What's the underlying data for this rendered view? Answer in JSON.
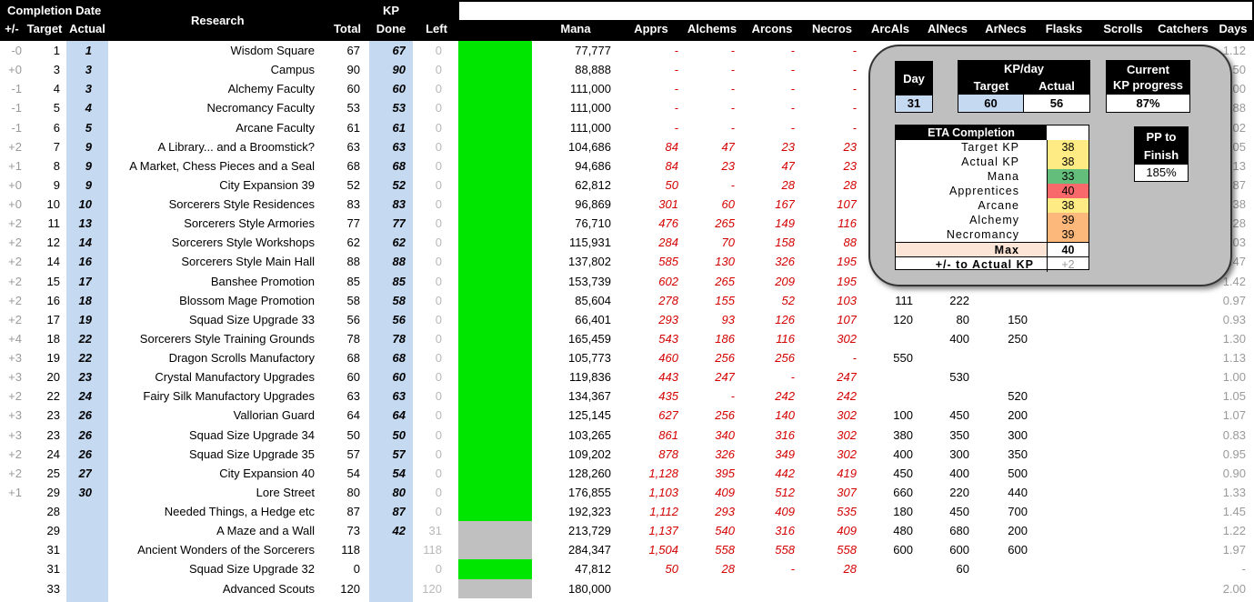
{
  "header": {
    "completion_date": "Completion Date",
    "research": "Research",
    "kp": "KP",
    "cols": {
      "pm": "+/-",
      "target": "Target",
      "actual": "Actual",
      "total": "Total",
      "done": "Done",
      "left": "Left",
      "mana": "Mana",
      "apprs": "Apprs",
      "alchems": "Alchems",
      "arcons": "Arcons",
      "necros": "Necros",
      "arcals": "ArcAls",
      "alnecs": "AlNecs",
      "arnecs": "ArNecs",
      "flasks": "Flasks",
      "scrolls": "Scrolls",
      "catchers": "Catchers",
      "days": "Days"
    }
  },
  "colors": {
    "green": "#00e600",
    "grey_bar": "#c0c0c0",
    "blue_col": "#c5d9f1"
  },
  "rows": [
    {
      "pm": "-0",
      "target": "1",
      "actual": "1",
      "research": "Wisdom Square",
      "total": "67",
      "done": "67",
      "left": "0",
      "bar": "green",
      "mana": "77,777",
      "apprs": "-",
      "alchems": "-",
      "arcons": "-",
      "necros": "-",
      "arcals": "",
      "alnecs": "",
      "arnecs": "",
      "days": "1.12"
    },
    {
      "pm": "+0",
      "target": "3",
      "actual": "3",
      "research": "Campus",
      "total": "90",
      "done": "90",
      "left": "0",
      "bar": "green",
      "mana": "88,888",
      "apprs": "-",
      "alchems": "-",
      "arcons": "-",
      "necros": "-",
      "arcals": "",
      "alnecs": "",
      "arnecs": "",
      "days": "1.50"
    },
    {
      "pm": "-1",
      "target": "4",
      "actual": "3",
      "research": "Alchemy Faculty",
      "total": "60",
      "done": "60",
      "left": "0",
      "bar": "green",
      "mana": "111,000",
      "apprs": "-",
      "alchems": "-",
      "arcons": "-",
      "necros": "-",
      "arcals": "",
      "alnecs": "",
      "arnecs": "",
      "days": "1.00"
    },
    {
      "pm": "-1",
      "target": "5",
      "actual": "4",
      "research": "Necromancy Faculty",
      "total": "53",
      "done": "53",
      "left": "0",
      "bar": "green",
      "mana": "111,000",
      "apprs": "-",
      "alchems": "-",
      "arcons": "-",
      "necros": "-",
      "arcals": "",
      "alnecs": "",
      "arnecs": "",
      "days": "0.88"
    },
    {
      "pm": "-1",
      "target": "6",
      "actual": "5",
      "research": "Arcane Faculty",
      "total": "61",
      "done": "61",
      "left": "0",
      "bar": "green",
      "mana": "111,000",
      "apprs": "-",
      "alchems": "-",
      "arcons": "-",
      "necros": "-",
      "arcals": "",
      "alnecs": "",
      "arnecs": "",
      "days": "1.02"
    },
    {
      "pm": "+2",
      "target": "7",
      "actual": "9",
      "research": "A Library... and a Broomstick?",
      "total": "63",
      "done": "63",
      "left": "0",
      "bar": "green",
      "mana": "104,686",
      "apprs": "84",
      "alchems": "47",
      "arcons": "23",
      "necros": "23",
      "arcals": "",
      "alnecs": "",
      "arnecs": "",
      "days": "1.05"
    },
    {
      "pm": "+1",
      "target": "8",
      "actual": "9",
      "research": "A Market, Chess Pieces and a Seal",
      "total": "68",
      "done": "68",
      "left": "0",
      "bar": "green",
      "mana": "94,686",
      "apprs": "84",
      "alchems": "23",
      "arcons": "47",
      "necros": "23",
      "arcals": "",
      "alnecs": "",
      "arnecs": "",
      "days": "1.13"
    },
    {
      "pm": "+0",
      "target": "9",
      "actual": "9",
      "research": "City Expansion 39",
      "total": "52",
      "done": "52",
      "left": "0",
      "bar": "green",
      "mana": "62,812",
      "apprs": "50",
      "alchems": "-",
      "arcons": "28",
      "necros": "28",
      "arcals": "",
      "alnecs": "",
      "arnecs": "",
      "days": "0.87"
    },
    {
      "pm": "+0",
      "target": "10",
      "actual": "10",
      "research": "Sorcerers Style Residences",
      "total": "83",
      "done": "83",
      "left": "0",
      "bar": "green",
      "mana": "96,869",
      "apprs": "301",
      "alchems": "60",
      "arcons": "167",
      "necros": "107",
      "arcals": "",
      "alnecs": "",
      "arnecs": "",
      "days": "1.38"
    },
    {
      "pm": "+2",
      "target": "11",
      "actual": "13",
      "research": "Sorcerers Style Armories",
      "total": "77",
      "done": "77",
      "left": "0",
      "bar": "green",
      "mana": "76,710",
      "apprs": "476",
      "alchems": "265",
      "arcons": "149",
      "necros": "116",
      "arcals": "",
      "alnecs": "",
      "arnecs": "",
      "days": "1.28"
    },
    {
      "pm": "+2",
      "target": "12",
      "actual": "14",
      "research": "Sorcerers Style Workshops",
      "total": "62",
      "done": "62",
      "left": "0",
      "bar": "green",
      "mana": "115,931",
      "apprs": "284",
      "alchems": "70",
      "arcons": "158",
      "necros": "88",
      "arcals": "",
      "alnecs": "",
      "arnecs": "",
      "days": "1.03"
    },
    {
      "pm": "+2",
      "target": "14",
      "actual": "16",
      "research": "Sorcerers Style Main Hall",
      "total": "88",
      "done": "88",
      "left": "0",
      "bar": "green",
      "mana": "137,802",
      "apprs": "585",
      "alchems": "130",
      "arcons": "326",
      "necros": "195",
      "arcals": "",
      "alnecs": "",
      "arnecs": "",
      "days": "1.47"
    },
    {
      "pm": "+2",
      "target": "15",
      "actual": "17",
      "research": "Banshee Promotion",
      "total": "85",
      "done": "85",
      "left": "0",
      "bar": "green",
      "mana": "153,739",
      "apprs": "602",
      "alchems": "265",
      "arcons": "209",
      "necros": "195",
      "arcals": "",
      "alnecs": "",
      "arnecs": "",
      "days": "1.42"
    },
    {
      "pm": "+2",
      "target": "16",
      "actual": "18",
      "research": "Blossom Mage Promotion",
      "total": "58",
      "done": "58",
      "left": "0",
      "bar": "green",
      "mana": "85,604",
      "apprs": "278",
      "alchems": "155",
      "arcons": "52",
      "necros": "103",
      "arcals": "111",
      "alnecs": "222",
      "arnecs": "",
      "days": "0.97"
    },
    {
      "pm": "+2",
      "target": "17",
      "actual": "19",
      "research": "Squad Size Upgrade 33",
      "total": "56",
      "done": "56",
      "left": "0",
      "bar": "green",
      "mana": "66,401",
      "apprs": "293",
      "alchems": "93",
      "arcons": "126",
      "necros": "107",
      "arcals": "120",
      "alnecs": "80",
      "arnecs": "150",
      "days": "0.93"
    },
    {
      "pm": "+4",
      "target": "18",
      "actual": "22",
      "research": "Sorcerers Style Training Grounds",
      "total": "78",
      "done": "78",
      "left": "0",
      "bar": "green",
      "mana": "165,459",
      "apprs": "543",
      "alchems": "186",
      "arcons": "116",
      "necros": "302",
      "arcals": "",
      "alnecs": "400",
      "arnecs": "250",
      "days": "1.30"
    },
    {
      "pm": "+3",
      "target": "19",
      "actual": "22",
      "research": "Dragon Scrolls Manufactory",
      "total": "68",
      "done": "68",
      "left": "0",
      "bar": "green",
      "mana": "105,773",
      "apprs": "460",
      "alchems": "256",
      "arcons": "256",
      "necros": "-",
      "arcals": "550",
      "alnecs": "",
      "arnecs": "",
      "days": "1.13"
    },
    {
      "pm": "+3",
      "target": "20",
      "actual": "23",
      "research": "Crystal Manufactory Upgrades",
      "total": "60",
      "done": "60",
      "left": "0",
      "bar": "green",
      "mana": "119,836",
      "apprs": "443",
      "alchems": "247",
      "arcons": "-",
      "necros": "247",
      "arcals": "",
      "alnecs": "530",
      "arnecs": "",
      "days": "1.00"
    },
    {
      "pm": "+2",
      "target": "22",
      "actual": "24",
      "research": "Fairy Silk Manufactory Upgrades",
      "total": "63",
      "done": "63",
      "left": "0",
      "bar": "green",
      "mana": "134,367",
      "apprs": "435",
      "alchems": "-",
      "arcons": "242",
      "necros": "242",
      "arcals": "",
      "alnecs": "",
      "arnecs": "520",
      "days": "1.05"
    },
    {
      "pm": "+3",
      "target": "23",
      "actual": "26",
      "research": "Vallorian Guard",
      "total": "64",
      "done": "64",
      "left": "0",
      "bar": "green",
      "mana": "125,145",
      "apprs": "627",
      "alchems": "256",
      "arcons": "140",
      "necros": "302",
      "arcals": "100",
      "alnecs": "450",
      "arnecs": "200",
      "days": "1.07"
    },
    {
      "pm": "+3",
      "target": "23",
      "actual": "26",
      "research": "Squad Size Upgrade 34",
      "total": "50",
      "done": "50",
      "left": "0",
      "bar": "green",
      "mana": "103,265",
      "apprs": "861",
      "alchems": "340",
      "arcons": "316",
      "necros": "302",
      "arcals": "380",
      "alnecs": "350",
      "arnecs": "300",
      "days": "0.83"
    },
    {
      "pm": "+2",
      "target": "24",
      "actual": "26",
      "research": "Squad Size Upgrade 35",
      "total": "57",
      "done": "57",
      "left": "0",
      "bar": "green",
      "mana": "109,202",
      "apprs": "878",
      "alchems": "326",
      "arcons": "349",
      "necros": "302",
      "arcals": "400",
      "alnecs": "300",
      "arnecs": "350",
      "days": "0.95"
    },
    {
      "pm": "+2",
      "target": "25",
      "actual": "27",
      "research": "City Expansion 40",
      "total": "54",
      "done": "54",
      "left": "0",
      "bar": "green",
      "mana": "128,260",
      "apprs": "1,128",
      "alchems": "395",
      "arcons": "442",
      "necros": "419",
      "arcals": "450",
      "alnecs": "400",
      "arnecs": "500",
      "days": "0.90"
    },
    {
      "pm": "+1",
      "target": "29",
      "actual": "30",
      "research": "Lore Street",
      "total": "80",
      "done": "80",
      "left": "0",
      "bar": "green",
      "mana": "176,855",
      "apprs": "1,103",
      "alchems": "409",
      "arcons": "512",
      "necros": "307",
      "arcals": "660",
      "alnecs": "220",
      "arnecs": "440",
      "days": "1.33"
    },
    {
      "pm": "",
      "target": "28",
      "actual": "",
      "research": "Needed Things, a Hedge etc",
      "total": "87",
      "done": "87",
      "left": "0",
      "bar": "green",
      "mana": "192,323",
      "apprs": "1,112",
      "alchems": "293",
      "arcons": "409",
      "necros": "535",
      "arcals": "180",
      "alnecs": "450",
      "arnecs": "700",
      "days": "1.45"
    },
    {
      "pm": "",
      "target": "29",
      "actual": "",
      "research": "A Maze and a Wall",
      "total": "73",
      "done": "42",
      "left": "31",
      "bar": "grey",
      "mana": "213,729",
      "apprs": "1,137",
      "alchems": "540",
      "arcons": "316",
      "necros": "409",
      "arcals": "480",
      "alnecs": "680",
      "arnecs": "200",
      "days": "1.22"
    },
    {
      "pm": "",
      "target": "31",
      "actual": "",
      "research": "Ancient Wonders of the Sorcerers",
      "total": "118",
      "done": "",
      "left": "118",
      "bar": "grey",
      "mana": "284,347",
      "apprs": "1,504",
      "alchems": "558",
      "arcons": "558",
      "necros": "558",
      "arcals": "600",
      "alnecs": "600",
      "arnecs": "600",
      "days": "1.97"
    },
    {
      "pm": "",
      "target": "31",
      "actual": "",
      "research": "Squad Size Upgrade 32",
      "total": "0",
      "done": "",
      "left": "0",
      "bar": "green",
      "mana": "47,812",
      "apprs": "50",
      "alchems": "28",
      "arcons": "-",
      "necros": "28",
      "arcals": "",
      "alnecs": "60",
      "arnecs": "",
      "days": "-"
    },
    {
      "pm": "",
      "target": "33",
      "actual": "",
      "research": "Advanced Scouts",
      "total": "120",
      "done": "",
      "left": "120",
      "bar": "grey",
      "mana": "180,000",
      "apprs": "",
      "alchems": "",
      "arcons": "",
      "necros": "",
      "arcals": "",
      "alnecs": "",
      "arnecs": "",
      "days": "2.00"
    }
  ],
  "panel": {
    "day_label": "Day",
    "day_value": "31",
    "kpday_label": "KP/day",
    "target_label": "Target",
    "actual_label": "Actual",
    "target_value": "60",
    "actual_value": "56",
    "current_label_1": "Current",
    "current_label_2": "KP progress",
    "current_value": "87%",
    "eta_title": "ETA Completion",
    "eta": [
      {
        "label": "Target KP",
        "value": "38",
        "color": "#ffeb84"
      },
      {
        "label": "Actual KP",
        "value": "38",
        "color": "#ffeb84"
      },
      {
        "label": "Mana",
        "value": "33",
        "color": "#63be7b"
      },
      {
        "label": "Apprentices",
        "value": "40",
        "color": "#f8696b"
      },
      {
        "label": "Arcane",
        "value": "38",
        "color": "#ffeb84"
      },
      {
        "label": "Alchemy",
        "value": "39",
        "color": "#fcb77a"
      },
      {
        "label": "Necromancy",
        "value": "39",
        "color": "#fcb77a"
      }
    ],
    "max_label": "Max",
    "max_value": "40",
    "pm_label": "+/- to Actual KP",
    "pm_value": "+2",
    "pp_label_1": "PP to",
    "pp_label_2": "Finish",
    "pp_value": "185%"
  }
}
